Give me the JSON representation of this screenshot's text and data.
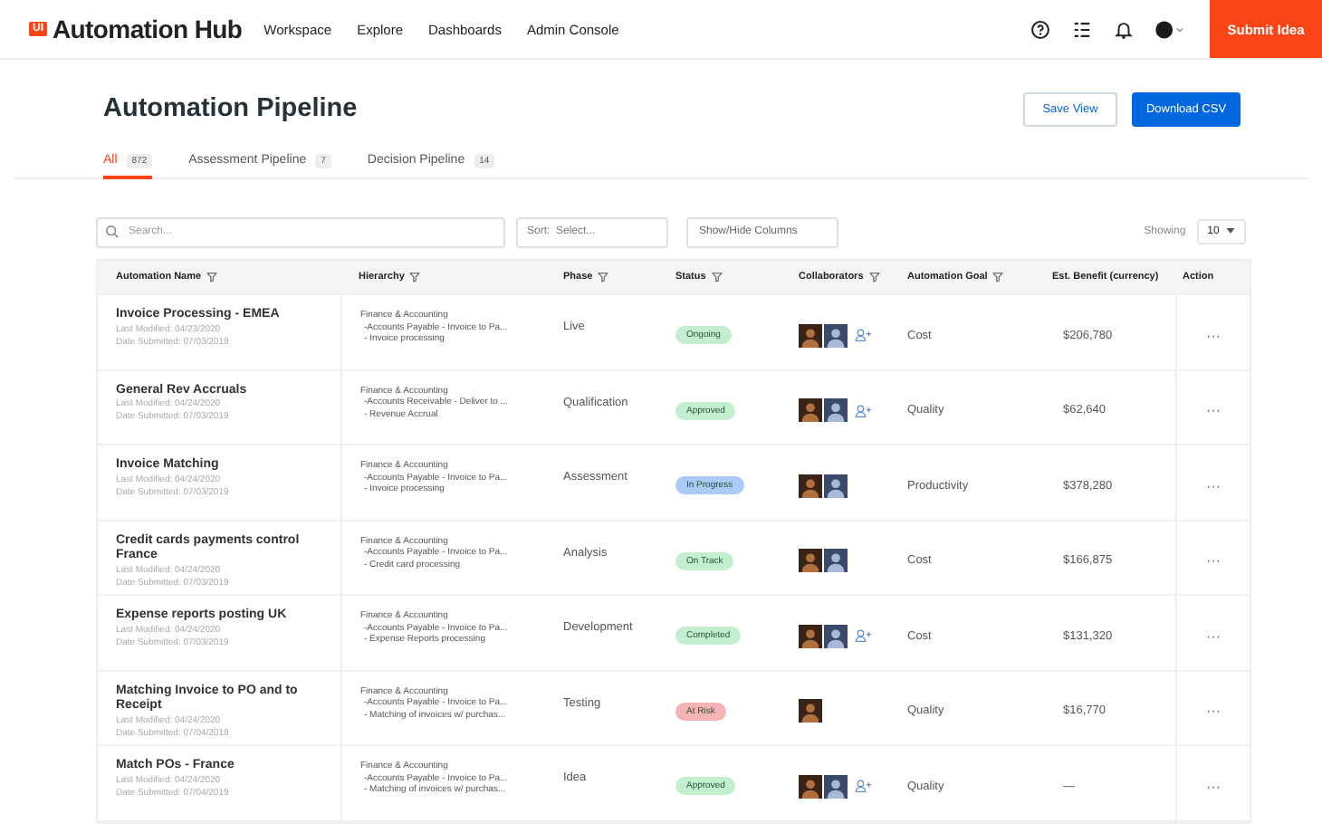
{
  "header": {
    "logo_mark": "UI",
    "logo_text": "Automation Hub",
    "nav": [
      "Workspace",
      "Explore",
      "Dashboards",
      "Admin Console"
    ],
    "submit_button": "Submit Idea"
  },
  "page": {
    "title": "Automation Pipeline",
    "buttons": [
      {
        "label": "Save View",
        "kind": "secondary"
      },
      {
        "label": "Download CSV",
        "kind": "primary"
      }
    ]
  },
  "tabs": [
    {
      "label": "All",
      "count": "872",
      "selected": true
    },
    {
      "label": "Assessment Pipeline",
      "count": "7",
      "selected": false
    },
    {
      "label": "Decision Pipeline",
      "count": "14",
      "selected": false
    }
  ],
  "toolbar": {
    "search": {
      "placeholder": "Search..."
    },
    "sort": {
      "label": "Sort:",
      "placeholder": "Select..."
    },
    "columns_button": "Show/Hide Columns",
    "showing_label": "Showing",
    "page_size": "10"
  },
  "table": {
    "columns": [
      {
        "label": "Automation Name",
        "filter": true
      },
      {
        "label": "Hierarchy",
        "filter": true
      },
      {
        "label": "Phase",
        "filter": true
      },
      {
        "label": "Status",
        "filter": true
      },
      {
        "label": "Collaborators",
        "filter": true
      },
      {
        "label": "Automation Goal",
        "filter": true
      },
      {
        "label": "Est. Benefit (currency)",
        "filter": false
      },
      {
        "label": "Action",
        "filter": false
      }
    ],
    "rows": [
      {
        "name": "Invoice Processing - EMEA",
        "modified": "Last Modified: 04/23/2020",
        "submitted": "Date Submitted: 07/03/2019",
        "hierarchy": [
          "Finance & Accounting",
          "-Accounts Payable - Invoice to Pa...",
          "- Invoice processing"
        ],
        "phase": "Live",
        "status": {
          "label": "Ongoing",
          "color": "#c4efcf"
        },
        "collaborators": [
          {
            "kind": "picture"
          },
          {
            "kind": "picture"
          }
        ],
        "invite": true,
        "goal": "Cost",
        "benefit": "$206,780",
        "action": "···"
      },
      {
        "name": "General Rev Accruals",
        "modified": "Last Modified: 04/24/2020",
        "submitted": "Date Submitted: 07/03/2019",
        "hierarchy": [
          "Finance & Accounting",
          "-Accounts Receivable - Deliver to ...",
          "- Revenue Accrual"
        ],
        "phase": "Qualification",
        "status": {
          "label": "Approved",
          "color": "#c4efcf"
        },
        "collaborators": [
          {
            "kind": "picture"
          },
          {
            "kind": "picture"
          }
        ],
        "invite": true,
        "goal": "Quality",
        "benefit": "$62,640",
        "action": "···"
      },
      {
        "name": "Invoice Matching",
        "modified": "Last Modified: 04/24/2020",
        "submitted": "Date Submitted: 07/03/2019",
        "hierarchy": [
          "Finance & Accounting",
          "-Accounts Payable - Invoice to Pa...",
          "- Invoice processing"
        ],
        "phase": "Assessment",
        "status": {
          "label": "In Progress",
          "color": "#abcaf5"
        },
        "collaborators": [
          {
            "kind": "picture"
          },
          {
            "kind": "picture"
          }
        ],
        "invite": false,
        "goal": "Productivity",
        "benefit": "$378,280",
        "action": "···"
      },
      {
        "name": "Credit cards payments control France",
        "modified": "Last Modified: 04/24/2020",
        "submitted": "Date Submitted: 07/03/2019",
        "hierarchy": [
          "Finance & Accounting",
          "-Accounts Payable - Invoice to Pa...",
          "- Credit card processing"
        ],
        "phase": "Analysis",
        "status": {
          "label": "On Track",
          "color": "#c4efcf"
        },
        "collaborators": [
          {
            "kind": "picture"
          },
          {
            "kind": "picture"
          }
        ],
        "invite": false,
        "goal": "Cost",
        "benefit": "$166,875",
        "action": "···"
      },
      {
        "name": "Expense reports posting UK",
        "modified": "Last Modified: 04/24/2020",
        "submitted": "Date Submitted: 07/03/2019",
        "hierarchy": [
          "Finance & Accounting",
          "-Accounts Payable - Invoice to Pa...",
          "- Expense Reports processing"
        ],
        "phase": "Development",
        "status": {
          "label": "Completed",
          "color": "#c4efcf"
        },
        "collaborators": [
          {
            "kind": "picture"
          },
          {
            "kind": "picture"
          }
        ],
        "invite": true,
        "goal": "Cost",
        "benefit": "$131,320",
        "action": "···"
      },
      {
        "name": "Matching Invoice to PO and to Receipt",
        "modified": "Last Modified: 04/24/2020",
        "submitted": "Date Submitted: 07/04/2019",
        "hierarchy": [
          "Finance & Accounting",
          "-Accounts Payable - Invoice to Pa...",
          "- Matching of invoices w/ purchas..."
        ],
        "phase": "Testing",
        "status": {
          "label": "At Risk",
          "color": "#f6b3b6"
        },
        "collaborators": [
          {
            "kind": "picture"
          }
        ],
        "invite": false,
        "goal": "Quality",
        "benefit": "$16,770",
        "action": "···"
      },
      {
        "name": "Match POs - France",
        "modified": "Last Modified: 04/24/2020",
        "submitted": "Date Submitted: 07/04/2019",
        "hierarchy": [
          "Finance & Accounting",
          "-Accounts Payable - Invoice to Pa...",
          "- Matching of invoices w/ purchas..."
        ],
        "phase": "Idea",
        "status": {
          "label": "Approved",
          "color": "#c4efcf"
        },
        "collaborators": [
          {
            "kind": "picture"
          },
          {
            "kind": "picture"
          }
        ],
        "invite": true,
        "goal": "Quality",
        "benefit": "—",
        "action": "···"
      }
    ]
  }
}
